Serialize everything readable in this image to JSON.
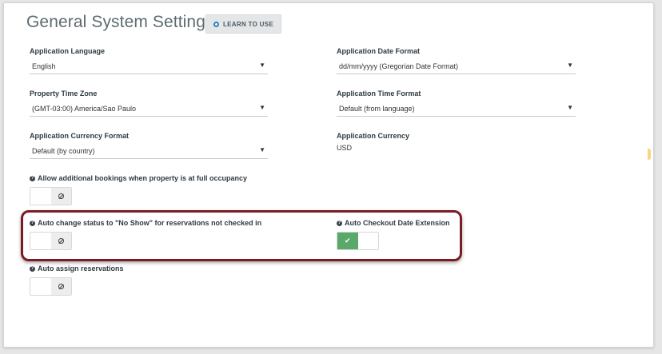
{
  "page": {
    "title": "General System Settings",
    "learn_button": "LEARN TO USE"
  },
  "fields": {
    "app_language": {
      "label": "Application Language",
      "value": "English"
    },
    "app_date_format": {
      "label": "Application Date Format",
      "value": "dd/mm/yyyy (Gregorian Date Format)"
    },
    "property_time_zone": {
      "label": "Property Time Zone",
      "value": "(GMT-03:00) America/Sao Paulo"
    },
    "app_time_format": {
      "label": "Application Time Format",
      "value": "Default (from language)"
    },
    "app_currency_format": {
      "label": "Application Currency Format",
      "value": "Default (by country)"
    },
    "app_currency": {
      "label": "Application Currency",
      "value": "USD"
    }
  },
  "toggles": {
    "full_occupancy": {
      "label": "Allow additional bookings when property is at full occupancy",
      "state": "off"
    },
    "no_show": {
      "label": "Auto change status to \"No Show\" for reservations not checked in",
      "state": "off"
    },
    "checkout_extension": {
      "label": "Auto Checkout Date Extension",
      "state": "on"
    },
    "auto_assign": {
      "label": "Auto assign reservations",
      "state": "off"
    }
  },
  "icons": {
    "dropdown": "caret-down-icon",
    "help": "question-circle-icon",
    "off": "ban-icon",
    "on": "check-icon"
  },
  "colors": {
    "toggle_on": "#5aa96b",
    "highlight_border": "#7a1c24",
    "learn_dot": "#2a7fc1"
  }
}
